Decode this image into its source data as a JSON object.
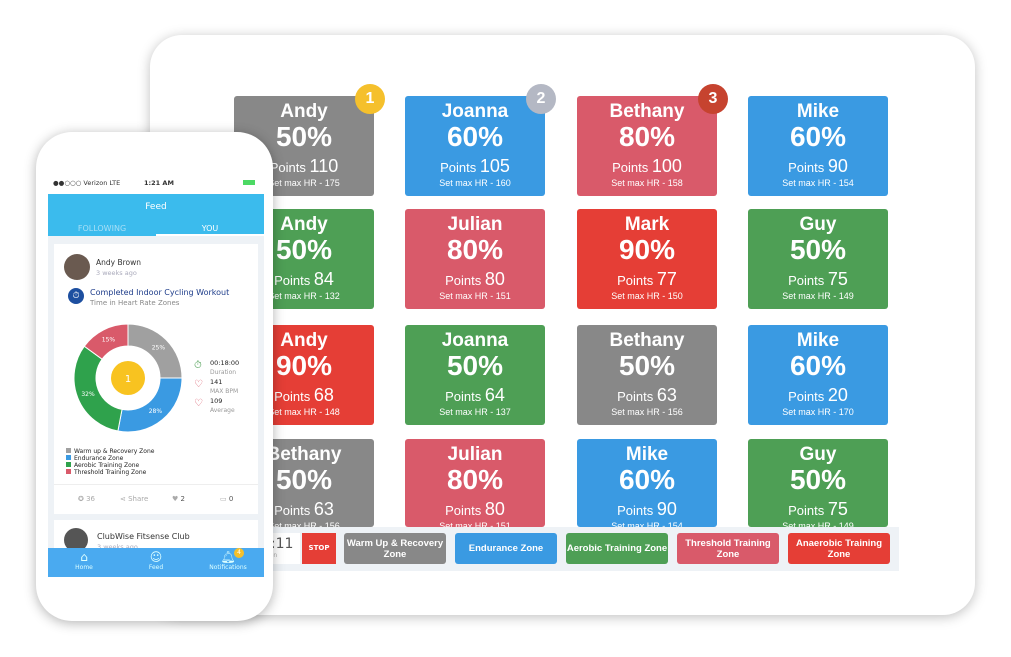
{
  "tablet": {
    "cards": [
      {
        "name": "Andy",
        "pct": "50%",
        "points": "110",
        "hr": "Set max HR - 175",
        "color": "#888888",
        "rank": "1",
        "rank_color": "#f5c02c"
      },
      {
        "name": "Joanna",
        "pct": "60%",
        "points": "105",
        "hr": "Set max HR - 160",
        "color": "#3a9ae2",
        "rank": "2",
        "rank_color": "#b4b8c4"
      },
      {
        "name": "Bethany",
        "pct": "80%",
        "points": "100",
        "hr": "Set max HR - 158",
        "color": "#d95a6a",
        "rank": "3",
        "rank_color": "#c6432f"
      },
      {
        "name": "Mike",
        "pct": "60%",
        "points": "90",
        "hr": "Set max HR - 154",
        "color": "#3a9ae2"
      },
      {
        "name": "Andy",
        "pct": "50%",
        "points": "84",
        "hr": "Set max HR - 132",
        "color": "#4e9f55"
      },
      {
        "name": "Julian",
        "pct": "80%",
        "points": "80",
        "hr": "Set max HR - 151",
        "color": "#d95a6a"
      },
      {
        "name": "Mark",
        "pct": "90%",
        "points": "77",
        "hr": "Set max HR - 150",
        "color": "#e53e36"
      },
      {
        "name": "Guy",
        "pct": "50%",
        "points": "75",
        "hr": "Set max HR - 149",
        "color": "#4e9f55"
      },
      {
        "name": "Andy",
        "pct": "90%",
        "points": "68",
        "hr": "Set max HR - 148",
        "color": "#e53e36"
      },
      {
        "name": "Joanna",
        "pct": "50%",
        "points": "64",
        "hr": "Set max HR - 137",
        "color": "#4e9f55"
      },
      {
        "name": "Bethany",
        "pct": "50%",
        "points": "63",
        "hr": "Set max HR - 156",
        "color": "#888888"
      },
      {
        "name": "Mike",
        "pct": "60%",
        "points": "20",
        "hr": "Set max HR - 170",
        "color": "#3a9ae2"
      },
      {
        "name": "Bethany",
        "pct": "50%",
        "points": "63",
        "hr": "Set max HR - 156",
        "color": "#888888"
      },
      {
        "name": "Julian",
        "pct": "80%",
        "points": "80",
        "hr": "Set max HR - 151",
        "color": "#d95a6a"
      },
      {
        "name": "Mike",
        "pct": "60%",
        "points": "90",
        "hr": "Set max HR - 154",
        "color": "#3a9ae2"
      },
      {
        "name": "Guy",
        "pct": "50%",
        "points": "75",
        "hr": "Set max HR - 149",
        "color": "#4e9f55"
      }
    ],
    "points_label": "Points",
    "timer": "5:11",
    "timer_label": "ation",
    "stop": "STOP",
    "zones": [
      {
        "label": "Warm Up & Recovery Zone",
        "color": "#888888"
      },
      {
        "label": "Endurance Zone",
        "color": "#3a9ae2"
      },
      {
        "label": "Aerobic Training Zone",
        "color": "#4e9f55"
      },
      {
        "label": "Threshold Training Zone",
        "color": "#d95a6a"
      },
      {
        "label": "Anaerobic Training Zone",
        "color": "#e53e36"
      }
    ]
  },
  "phone": {
    "status": {
      "carrier": "●●○○○ Verizon  LTE",
      "time": "1:21 AM"
    },
    "header": "Feed",
    "tabs": [
      "FOLLOWING",
      "YOU"
    ],
    "post": {
      "user": "Andy Brown",
      "time": "3 weeks ago",
      "title": "Completed Indoor Cycling Workout",
      "subtitle": "Time in Heart Rate Zones",
      "chart_data": {
        "type": "pie",
        "values": [
          25,
          28,
          32,
          15
        ],
        "labels": [
          "25%",
          "28%",
          "32%",
          "15%"
        ],
        "colors": [
          "#a0a0a0",
          "#3a9ae2",
          "#2fa24c",
          "#d95a6a"
        ]
      },
      "stats": [
        {
          "value": "00:18:00",
          "label": "Duration"
        },
        {
          "value": "141",
          "label": "MAX BPM"
        },
        {
          "value": "109",
          "label": "Average"
        }
      ],
      "legend": [
        "Warm up & Recovery Zone",
        "Endurance Zone",
        "Aerobic Training Zone",
        "Threshold Training Zone"
      ],
      "actions": {
        "kudos": "36",
        "share": "Share",
        "likes": "2",
        "comments": "0"
      }
    },
    "post2": {
      "user": "ClubWise Fitsense Club",
      "time": "3 weeks ago"
    },
    "nav": [
      {
        "label": "Home"
      },
      {
        "label": "Feed"
      },
      {
        "label": "Notifications",
        "badge": "4"
      }
    ]
  }
}
